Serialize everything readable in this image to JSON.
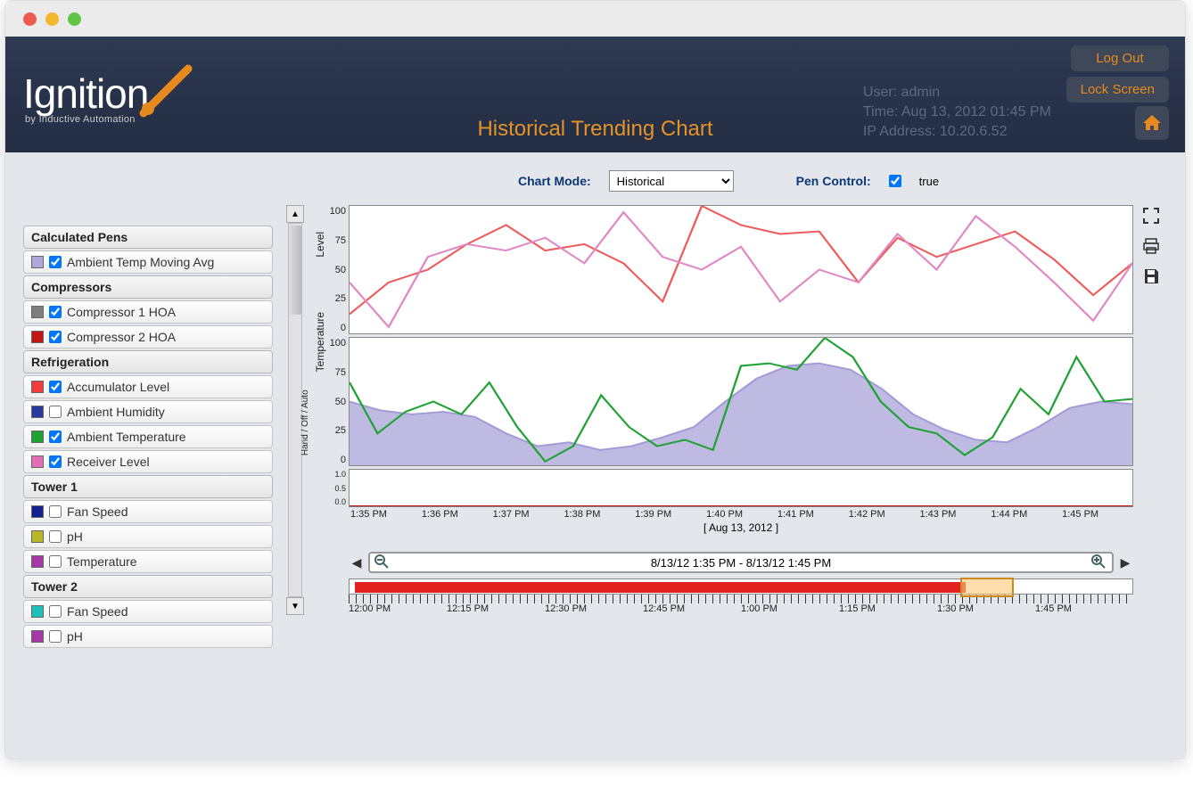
{
  "header": {
    "logo_text": "Ignition",
    "logo_sub": "by Inductive Automation",
    "page_title": "Historical Trending Chart",
    "user_label": "User:",
    "user_value": "admin",
    "time_label": "Time:",
    "time_value": "Aug 13, 2012 01:45 PM",
    "ip_label": "IP Address:",
    "ip_value": "10.20.6.52",
    "logout": "Log Out",
    "lockscreen": "Lock Screen"
  },
  "controls": {
    "mode_label": "Chart Mode:",
    "mode_value": "Historical",
    "pen_label": "Pen Control:",
    "pen_value": "true"
  },
  "pens": {
    "groups": [
      {
        "name": "Calculated Pens",
        "items": [
          {
            "label": "Ambient Temp Moving Avg",
            "color": "#aea7da",
            "checked": true
          }
        ]
      },
      {
        "name": "Compressors",
        "items": [
          {
            "label": "Compressor 1 HOA",
            "color": "#7e7e7e",
            "checked": true
          },
          {
            "label": "Compressor 2 HOA",
            "color": "#c11616",
            "checked": true
          }
        ]
      },
      {
        "name": "Refrigeration",
        "items": [
          {
            "label": "Accumulator Level",
            "color": "#ef3c3c",
            "checked": true
          },
          {
            "label": "Ambient Humidity",
            "color": "#2a3a9c",
            "checked": false
          },
          {
            "label": "Ambient Temperature",
            "color": "#1ea233",
            "checked": true
          },
          {
            "label": "Receiver Level",
            "color": "#e06fb8",
            "checked": true
          }
        ]
      },
      {
        "name": "Tower 1",
        "items": [
          {
            "label": "Fan Speed",
            "color": "#14208c",
            "checked": false
          },
          {
            "label": "pH",
            "color": "#b8b829",
            "checked": false
          },
          {
            "label": "Temperature",
            "color": "#a538a5",
            "checked": false
          }
        ]
      },
      {
        "name": "Tower 2",
        "items": [
          {
            "label": "Fan Speed",
            "color": "#1fc0bc",
            "checked": false
          },
          {
            "label": "pH",
            "color": "#a538a5",
            "checked": false
          }
        ]
      }
    ]
  },
  "range": {
    "text": "8/13/12 1:35 PM - 8/13/12 1:45 PM",
    "date_label": "[ Aug 13, 2012 ]"
  },
  "overview_times": [
    "12:00 PM",
    "12:15 PM",
    "12:30 PM",
    "12:45 PM",
    "1:00 PM",
    "1:15 PM",
    "1:30 PM",
    "1:45 PM"
  ],
  "chart_data": [
    {
      "type": "line",
      "title": "",
      "xlabel": "",
      "ylabel": "Level",
      "ylim": [
        0,
        100
      ],
      "x": [
        "1:35 PM",
        "1:36 PM",
        "1:37 PM",
        "1:38 PM",
        "1:39 PM",
        "1:40 PM",
        "1:41 PM",
        "1:42 PM",
        "1:43 PM",
        "1:44 PM",
        "1:45 PM"
      ],
      "series": [
        {
          "name": "Accumulator Level",
          "color": "#ef5a5a",
          "values": [
            15,
            40,
            50,
            70,
            85,
            65,
            70,
            55,
            25,
            100,
            85,
            78,
            80,
            40,
            75,
            60,
            70,
            80,
            58,
            30,
            55
          ]
        },
        {
          "name": "Receiver Level",
          "color": "#e287c5",
          "values": [
            40,
            5,
            60,
            70,
            65,
            75,
            55,
            95,
            60,
            50,
            68,
            25,
            50,
            40,
            78,
            50,
            92,
            68,
            40,
            10,
            55
          ]
        }
      ]
    },
    {
      "type": "line",
      "title": "",
      "xlabel": "",
      "ylabel": "Temperature",
      "ylim": [
        0,
        100
      ],
      "x": [
        "1:35 PM",
        "1:36 PM",
        "1:37 PM",
        "1:38 PM",
        "1:39 PM",
        "1:40 PM",
        "1:41 PM",
        "1:42 PM",
        "1:43 PM",
        "1:44 PM",
        "1:45 PM"
      ],
      "series": [
        {
          "name": "Ambient Temp Moving Avg",
          "color": "#a29cd6",
          "fill": true,
          "values": [
            50,
            43,
            40,
            42,
            38,
            25,
            15,
            18,
            12,
            15,
            22,
            30,
            50,
            68,
            78,
            80,
            75,
            60,
            40,
            28,
            20,
            18,
            30,
            45,
            50,
            48
          ]
        },
        {
          "name": "Ambient Temperature",
          "color": "#1ea233",
          "values": [
            65,
            25,
            42,
            50,
            40,
            65,
            30,
            3,
            15,
            55,
            30,
            15,
            20,
            12,
            78,
            80,
            75,
            100,
            85,
            50,
            30,
            25,
            8,
            22,
            60,
            40,
            85,
            50,
            52
          ]
        }
      ]
    },
    {
      "type": "line",
      "title": "",
      "xlabel": "[ Aug 13, 2012 ]",
      "ylabel": "Hand / Off / Auto",
      "ylim": [
        0.0,
        1.0
      ],
      "x": [
        "1:35 PM",
        "1:36 PM",
        "1:37 PM",
        "1:38 PM",
        "1:39 PM",
        "1:40 PM",
        "1:41 PM",
        "1:42 PM",
        "1:43 PM",
        "1:44 PM",
        "1:45 PM"
      ],
      "series": [
        {
          "name": "Compressor 1 HOA",
          "color": "#7e7e7e",
          "values": [
            0,
            0,
            0,
            0,
            0,
            0,
            0,
            0,
            0,
            0,
            0
          ]
        },
        {
          "name": "Compressor 2 HOA",
          "color": "#c11616",
          "values": [
            0,
            0,
            0,
            0,
            0,
            0,
            0,
            0,
            0,
            0,
            0
          ]
        }
      ]
    }
  ]
}
